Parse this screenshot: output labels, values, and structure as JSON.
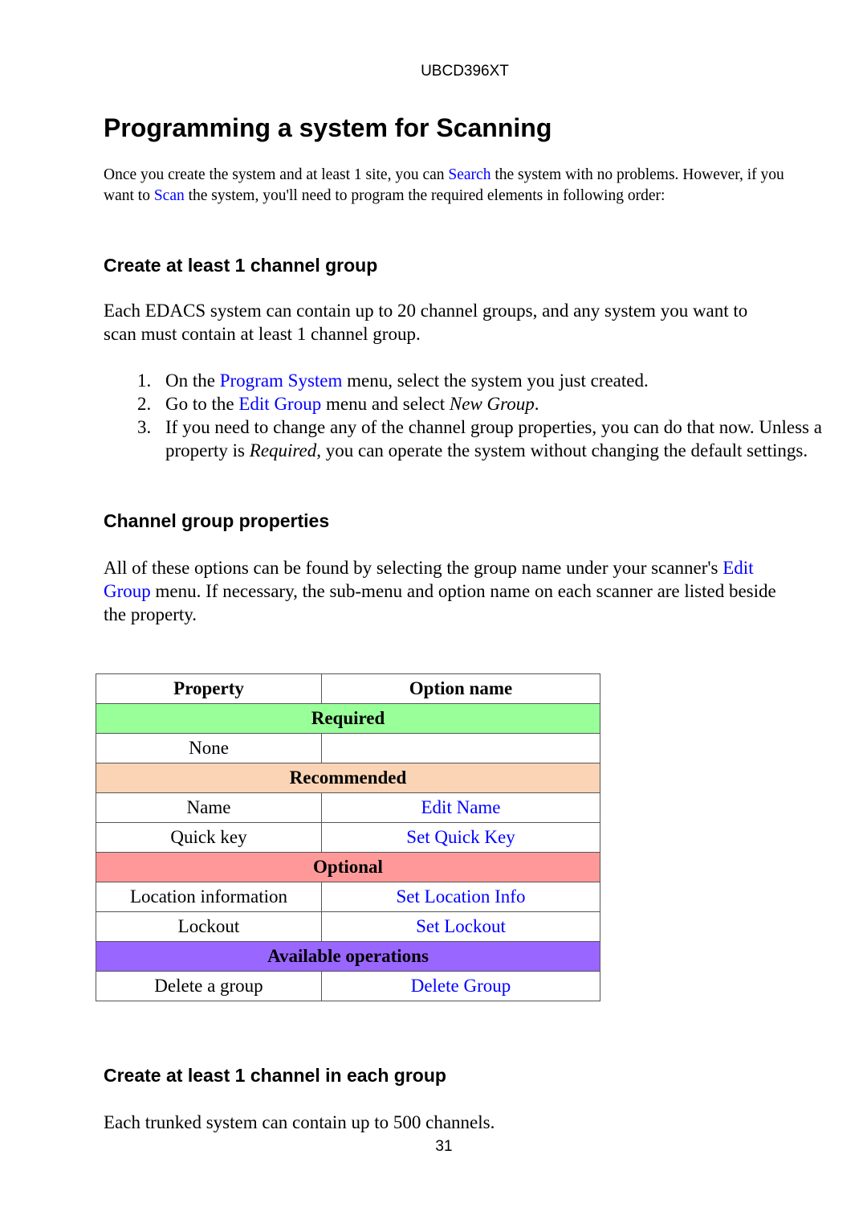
{
  "running_head": "UBCD396XT",
  "title": "Programming a system for Scanning",
  "intro": {
    "before_search": "Once you create the system and at least 1 site, you can ",
    "search_link": "Search",
    "after_search": " the system with no problems. However, if you want to ",
    "scan_link": "Scan",
    "after_scan": " the system, you'll need to program the required elements in following order:"
  },
  "section1": {
    "heading": "Create at least 1 channel group",
    "paragraph": "Each EDACS system can contain up to 20 channel groups, and any system you want to scan must contain at least 1 channel group.",
    "steps": [
      {
        "number": "1.",
        "before": "On the ",
        "link": "Program System",
        "after": " menu, select the system you just created."
      },
      {
        "number": "2.",
        "before": "Go to the ",
        "link": "Edit Group",
        "after": " menu and select ",
        "italic": "New Group",
        "end": "."
      },
      {
        "number": "3.",
        "before": "If you need to change any of the channel group properties, you can do that now. Unless a property is ",
        "italic": "Required",
        "after": ", you can operate the system without changing the default settings."
      }
    ]
  },
  "section2": {
    "heading": "Channel group properties",
    "before_link": "All of these options can be found by selecting the group name under your scanner's ",
    "link": "Edit Group",
    "after_link": " menu. If necessary, the sub-menu and option name on each scanner are listed beside the property."
  },
  "table": {
    "headers": [
      "Property",
      "Option name"
    ],
    "sections": [
      {
        "label": "Required",
        "color": "#99ff99",
        "rows": [
          {
            "property": "None",
            "option": ""
          }
        ]
      },
      {
        "label": "Recommended",
        "color": "#fad4b4",
        "rows": [
          {
            "property": "Name",
            "option": "Edit Name"
          },
          {
            "property": "Quick key",
            "option": "Set Quick Key"
          }
        ]
      },
      {
        "label": "Optional",
        "color": "#ff9999",
        "rows": [
          {
            "property": "Location information",
            "option": "Set Location Info"
          },
          {
            "property": "Lockout",
            "option": "Set Lockout"
          }
        ]
      },
      {
        "label": "Available operations",
        "color": "#9966ff",
        "rows": [
          {
            "property": "Delete a group",
            "option": "Delete Group"
          }
        ]
      }
    ]
  },
  "section3": {
    "heading": "Create at least 1 channel in each group",
    "paragraph": "Each trunked system can contain up to 500 channels."
  },
  "page_number": "31",
  "colors": {
    "link": "#0000ff",
    "text": "#000000"
  }
}
